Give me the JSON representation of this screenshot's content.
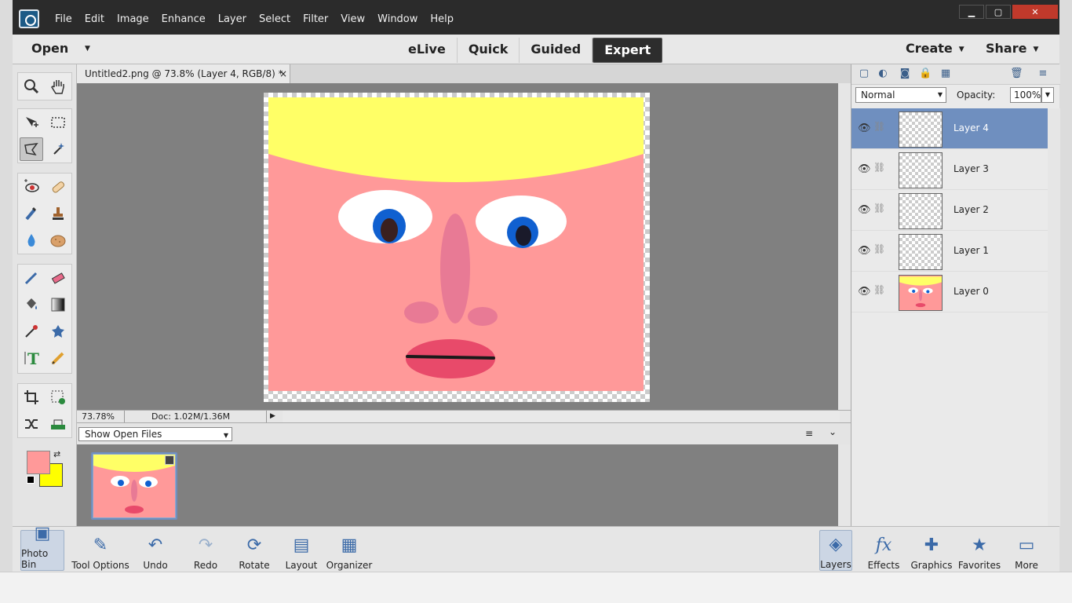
{
  "menu": [
    "File",
    "Edit",
    "Image",
    "Enhance",
    "Layer",
    "Select",
    "Filter",
    "View",
    "Window",
    "Help"
  ],
  "window_controls": {
    "minimize": "▁",
    "restore": "▢",
    "close": "✕"
  },
  "modebar": {
    "open_label": "Open",
    "modes": [
      "eLive",
      "Quick",
      "Guided",
      "Expert"
    ],
    "active_mode": "Expert",
    "create_label": "Create",
    "share_label": "Share"
  },
  "document": {
    "tab_title": "Untitled2.png @ 73.8% (Layer 4, RGB/8) *",
    "tab_close": "×"
  },
  "status": {
    "zoom": "73.78%",
    "doc_size": "Doc: 1.02M/1.36M"
  },
  "photo_bin": {
    "show_label": "Show Open Files"
  },
  "layers_panel": {
    "blend_mode": "Normal",
    "opacity_label": "Opacity:",
    "opacity_value": "100%",
    "layers": [
      {
        "name": "Layer 4",
        "selected": true
      },
      {
        "name": "Layer 3",
        "selected": false
      },
      {
        "name": "Layer 2",
        "selected": false
      },
      {
        "name": "Layer 1",
        "selected": false
      },
      {
        "name": "Layer 0",
        "selected": false
      }
    ]
  },
  "taskbar": {
    "left": [
      "Photo Bin",
      "Tool Options",
      "Undo",
      "Redo",
      "Rotate",
      "Layout",
      "Organizer"
    ],
    "right": [
      "Layers",
      "Effects",
      "Graphics",
      "Favorites",
      "More"
    ]
  },
  "colors": {
    "foreground": "#ff9999",
    "background": "#ffff00",
    "accent": "#6f8fbf",
    "face_skin": "#ff9999",
    "hair": "#ffff66",
    "lips": "#e84a6a",
    "iris": "#1060d0"
  }
}
